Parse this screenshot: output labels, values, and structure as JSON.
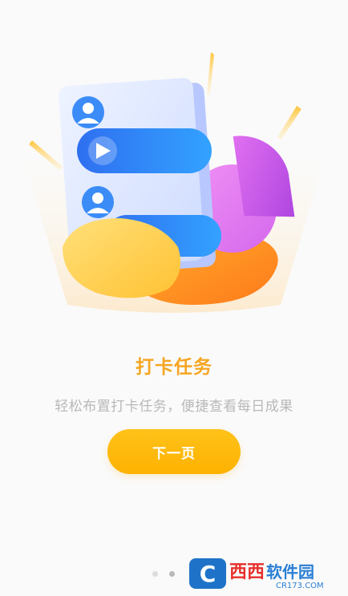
{
  "onboarding": {
    "title": "打卡任务",
    "subtitle": "轻松布置打卡任务，便捷查看每日成果",
    "next_button_label": "下一页",
    "page_indicator": {
      "total": 2,
      "current": 2
    }
  },
  "illustration": {
    "icons": [
      "user-icon",
      "play-icon",
      "user-icon"
    ],
    "colors": {
      "accent": "#f5a623",
      "button": "#fdb200",
      "blue_bar": "#2f86f6",
      "pie": "#d86ef0"
    }
  },
  "watermark": {
    "logo_letter": "C",
    "brand_part1": "西西",
    "brand_part2": "软件园",
    "domain": "CR173.COM"
  }
}
